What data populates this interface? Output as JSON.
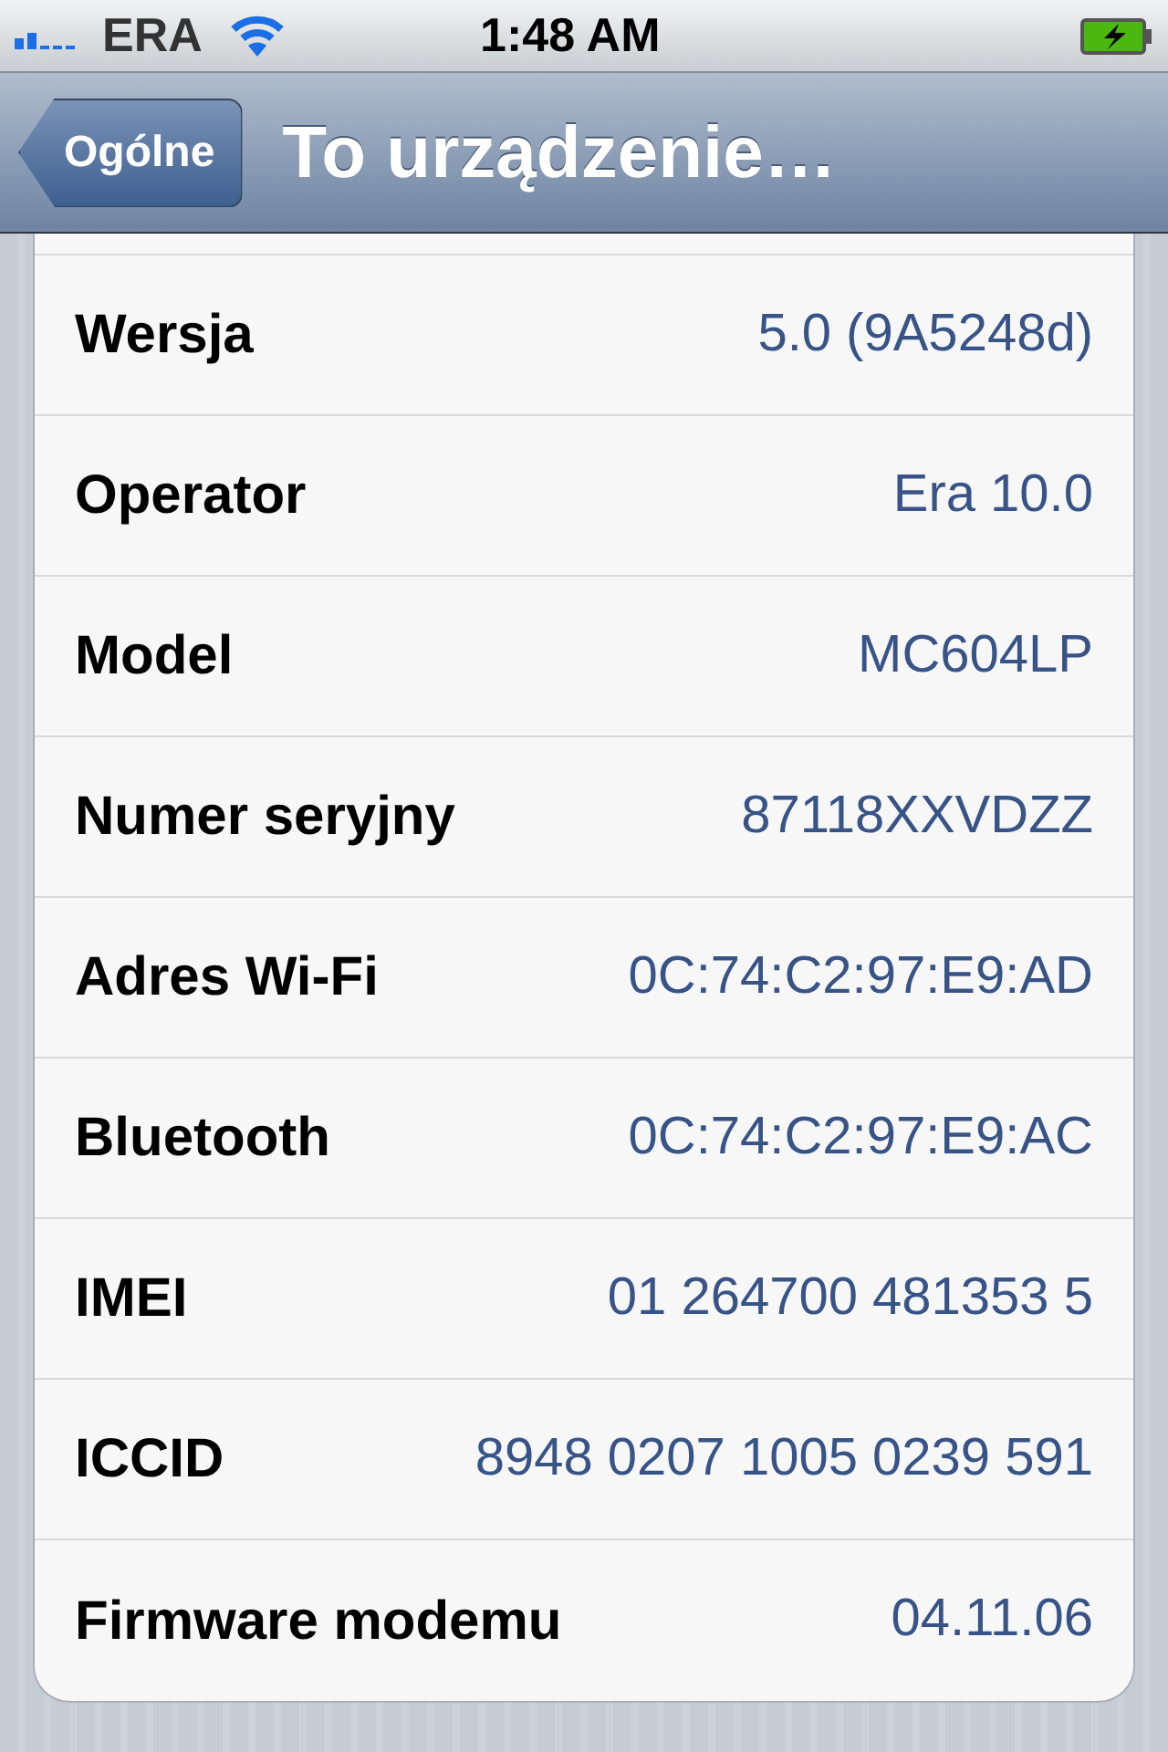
{
  "status_bar": {
    "carrier": "ERA",
    "time": "1:48 AM"
  },
  "nav_bar": {
    "back_button": "Ogólne",
    "title": "To urządzenie…"
  },
  "rows": [
    {
      "label": "Wersja",
      "value": "5.0 (9A5248d)"
    },
    {
      "label": "Operator",
      "value": "Era 10.0"
    },
    {
      "label": "Model",
      "value": "MC604LP"
    },
    {
      "label": "Numer seryjny",
      "value": "87118XXVDZZ"
    },
    {
      "label": "Adres Wi-Fi",
      "value": "0C:74:C2:97:E9:AD"
    },
    {
      "label": "Bluetooth",
      "value": "0C:74:C2:97:E9:AC"
    },
    {
      "label": "IMEI",
      "value": "01 264700 481353 5"
    },
    {
      "label": "ICCID",
      "value": "8948 0207 1005 0239 591"
    },
    {
      "label": "Firmware modemu",
      "value": "04.11.06"
    }
  ]
}
